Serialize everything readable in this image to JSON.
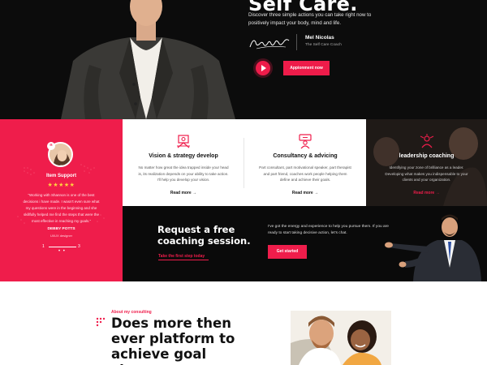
{
  "hero": {
    "title": "Self Care.",
    "description": "Discover three simple actions you can take right now to positively impact your body, mind and life.",
    "author_name": "Mel Nicolas",
    "author_role": "The Self Care Coach",
    "appointment_label": "Appionment now"
  },
  "testimonial": {
    "title": "Item Support",
    "stars": "★★★★★",
    "quote": "“Working with Shannon is one of the best decisions i have made. I wasn't even sure what my questions were in the beginning and she skillfully helped me find the steps that were the most effective in reaching my goals.”",
    "author": "DEBBY POTTS",
    "author_role": "UI/UX designer",
    "page_start": "1",
    "page_end": "3"
  },
  "services": [
    {
      "title": "Vision & strategy develop",
      "text": "No matter how great the idea trapped inside your head is, its realization depends on your ability to take action. I'll help you develop your vision.",
      "more": "Read more"
    },
    {
      "title": "Consultancy & advicing",
      "text": "Part consultant, part motivational speaker, part therapist and part friend, coaches work people helping them define and achieve their goals.",
      "more": "Read more"
    },
    {
      "title": "leadership coaching",
      "text": "Identifying your zone of brilliance as a leader. Developing what makes you indispensable to your clients and your organization.",
      "more": "Read more"
    }
  ],
  "cta": {
    "title": "Request a free coaching session.",
    "link": "Take the first step today",
    "text": "I've got the energy and experience to help you pursue them. If you are ready to start taking decisive action, let's chat.",
    "button": "Get started"
  },
  "about": {
    "eyebrow": "About my consulting",
    "title": "Does more then ever platform to achieve goal stages"
  },
  "colors": {
    "accent": "#ef1d4b",
    "dark": "#0c0c0c"
  }
}
